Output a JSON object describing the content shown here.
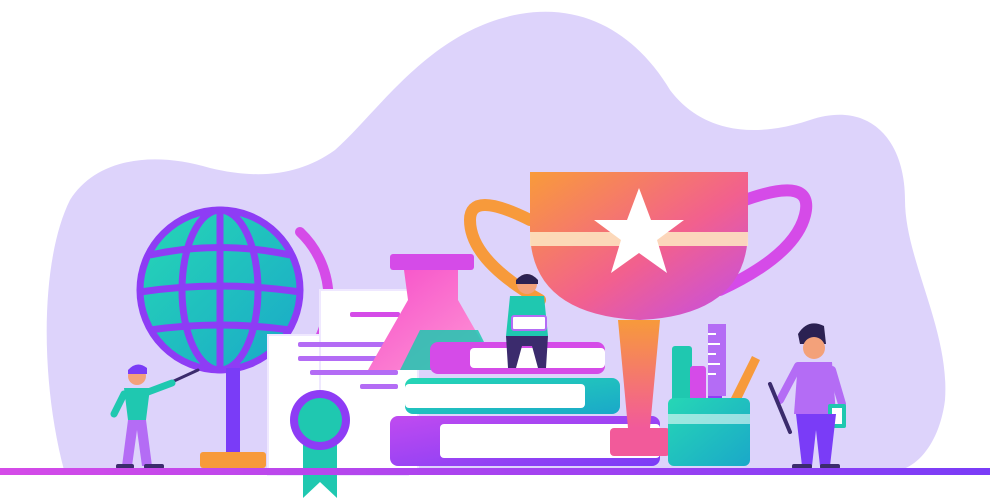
{
  "illustration": {
    "elements": [
      "background-blob",
      "globe",
      "certificate",
      "award-rosette",
      "flask",
      "book-stack",
      "trophy",
      "star-icon",
      "pencil-cup",
      "ruler",
      "student-pointing",
      "student-reading",
      "student-with-clipboard"
    ]
  },
  "palette": {
    "blob": "#ddd3fb",
    "purple": "#8e3cf5",
    "magenta": "#d54be8",
    "teal": "#1fc8b0",
    "orange": "#f79a3b",
    "pink": "#f25a9a",
    "floor": "#b25cf2"
  }
}
